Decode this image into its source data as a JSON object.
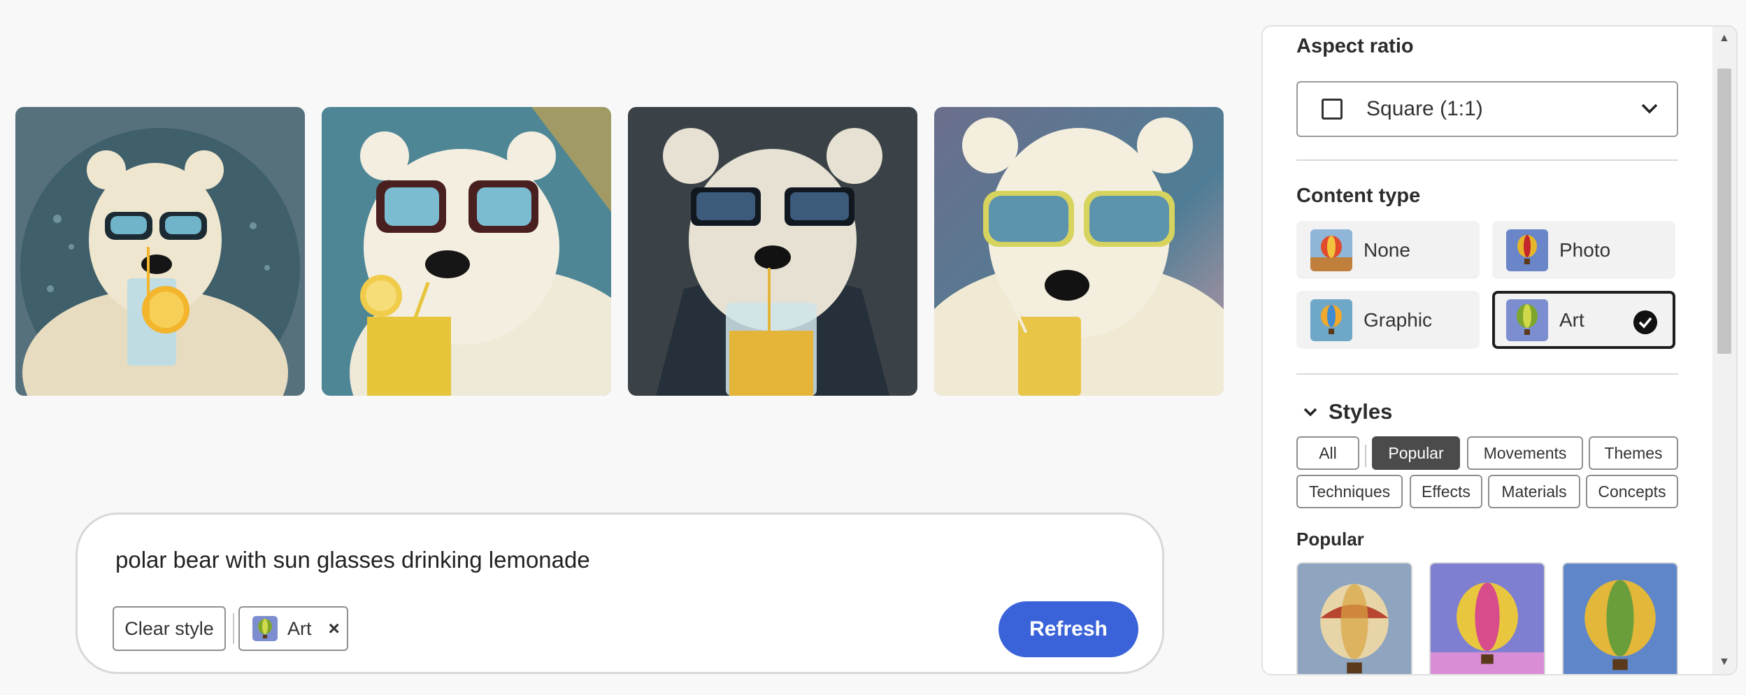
{
  "results": [
    {
      "name": "result-image-1",
      "bg": "#52707d",
      "accent": "#f2b52b"
    },
    {
      "name": "result-image-2",
      "bg": "#4f8795",
      "accent": "#e9c547"
    },
    {
      "name": "result-image-3",
      "bg": "#3c4247",
      "accent": "#e5b53a"
    },
    {
      "name": "result-image-4",
      "bg": "#6f7c92",
      "accent": "#e9c547"
    }
  ],
  "prompt": {
    "text": "polar bear with sun glasses drinking lemonade",
    "clear_style_label": "Clear style",
    "art_chip_label": "Art",
    "remove_icon": "×",
    "refresh_label": "Refresh"
  },
  "panel": {
    "aspect_ratio_heading": "Aspect ratio",
    "aspect_ratio_value": "Square (1:1)",
    "content_type_heading": "Content type",
    "content_types": [
      {
        "label": "None",
        "selected": false
      },
      {
        "label": "Photo",
        "selected": false
      },
      {
        "label": "Graphic",
        "selected": false
      },
      {
        "label": "Art",
        "selected": true
      }
    ],
    "styles_heading": "Styles",
    "style_tabs": [
      "All",
      "Popular",
      "Movements",
      "Themes",
      "Techniques",
      "Effects",
      "Materials",
      "Concepts"
    ],
    "active_style_tab": "Popular",
    "popular_heading": "Popular"
  },
  "colors": {
    "accent": "#3b63d9",
    "active_tab": "#4b4b4b"
  }
}
